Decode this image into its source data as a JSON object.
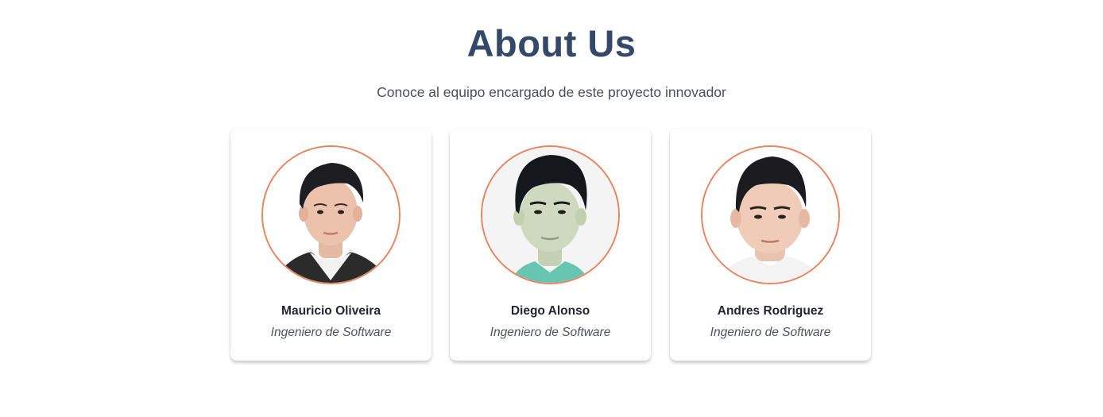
{
  "header": {
    "title": "About Us",
    "subtitle": "Conoce al equipo encargado de este proyecto innovador"
  },
  "team": [
    {
      "name": "Mauricio Oliveira",
      "role": "Ingeniero de Software",
      "photo": "portrait-photo"
    },
    {
      "name": "Diego Alonso",
      "role": "Ingeniero de Software",
      "photo": "portrait-photo"
    },
    {
      "name": "Andres Rodriguez",
      "role": "Ingeniero de Software",
      "photo": "portrait-photo"
    }
  ],
  "colors": {
    "title": "#34486a",
    "avatar_border": "#e8845f",
    "text": "#23262e"
  }
}
